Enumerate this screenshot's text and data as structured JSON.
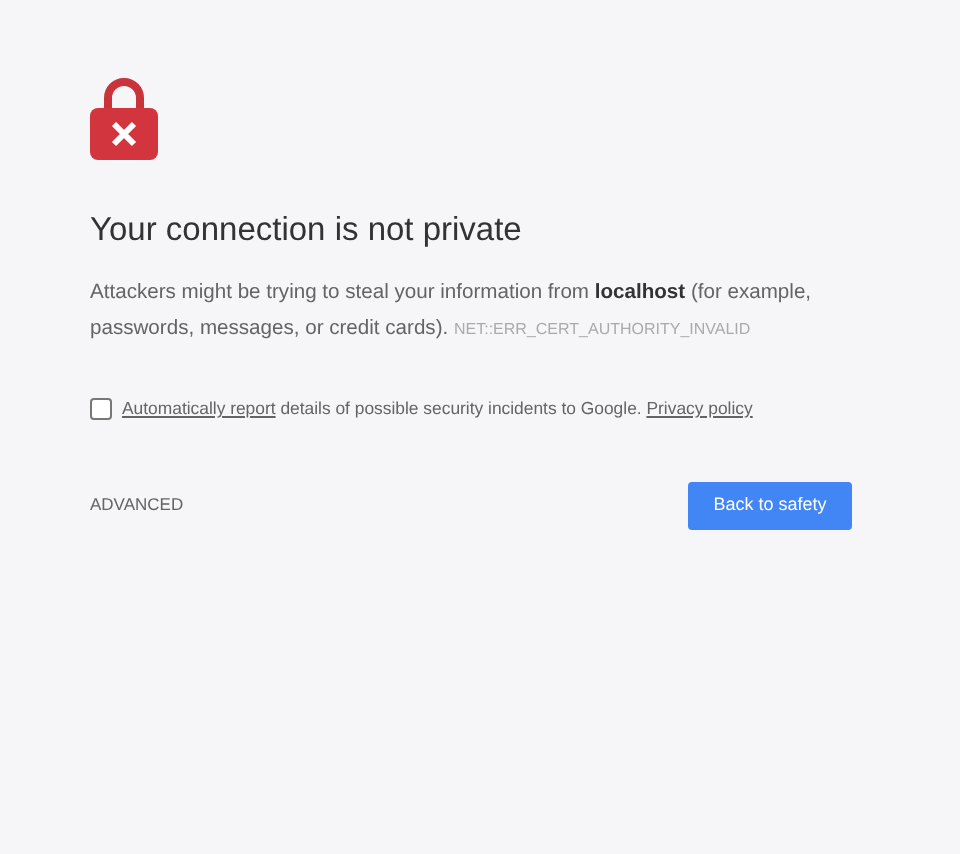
{
  "heading": "Your connection is not private",
  "message": {
    "text": "Attackers might be trying to steal your information from **localhost** (for example, passwords, messages, or credit cards).",
    "error_code": "NET::ERR_CERT_AUTHORITY_INVALID"
  },
  "report": {
    "checked": false,
    "link": "Automatically report",
    "text": "details of possible security incidents to Google.",
    "privacy_link": "Privacy policy"
  },
  "advanced_button": "ADVANCED",
  "back_button": "Back to safety"
}
